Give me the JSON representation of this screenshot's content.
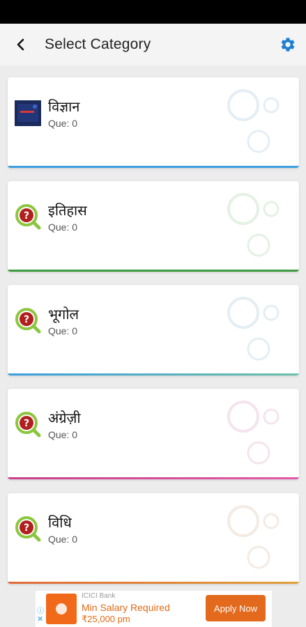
{
  "header": {
    "title": "Select Category"
  },
  "categories": [
    {
      "name": "विज्ञान",
      "que": "Que: 0",
      "icon": "thumbnail-image",
      "accent": "#3aa0e0",
      "bubble": "#e4eef4"
    },
    {
      "name": "इतिहास",
      "que": "Que: 0",
      "icon": "question-search-icon",
      "accent": "#3e9a3e",
      "bubble": "#e4f1e4"
    },
    {
      "name": "भूगोल",
      "que": "Que: 0",
      "icon": "question-search-icon",
      "accent": "#4aa0c8",
      "bubble": "#e4eef2"
    },
    {
      "name": "अंग्रेज़ी",
      "que": "Que: 0",
      "icon": "question-search-icon",
      "accent": "#d24fa0",
      "bubble": "#f4e4ee"
    },
    {
      "name": "विधि",
      "que": "Que: 0",
      "icon": "question-search-icon",
      "accent": "#e08a3a",
      "bubble": "#f3ebe3"
    }
  ],
  "ad": {
    "bank": "ICICI Bank",
    "headline": "Min Salary Required",
    "subline": "₹25,000 pm",
    "cta": "Apply Now",
    "info_icon": "info-icon",
    "close_icon": "close-icon"
  },
  "colors": {
    "accent_blue": "#1e7fd0",
    "question_icon_green": "#8cc63f",
    "question_icon_red": "#b21f1f",
    "ad_orange": "#e3691c"
  }
}
